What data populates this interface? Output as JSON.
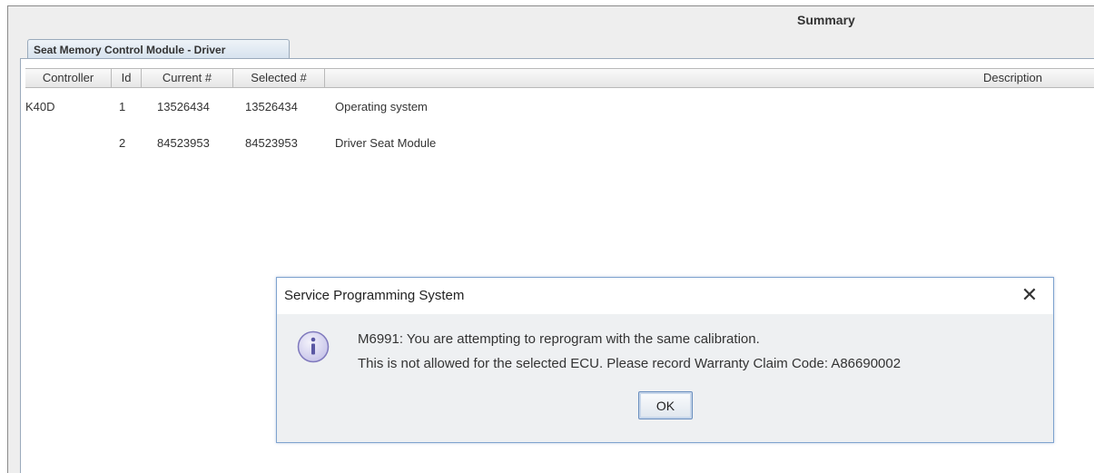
{
  "summary": {
    "title": "Summary"
  },
  "tab": {
    "label": "Seat Memory Control Module - Driver"
  },
  "table": {
    "columns": [
      "Controller",
      "Id",
      "Current #",
      "Selected #",
      "Description"
    ],
    "rows": [
      {
        "controller": "K40D",
        "id": "1",
        "current": "13526434",
        "selected": "13526434",
        "description": "Operating system"
      },
      {
        "controller": "",
        "id": "2",
        "current": "84523953",
        "selected": "84523953",
        "description": "Driver Seat Module"
      }
    ]
  },
  "dialog": {
    "title": "Service Programming System",
    "close_glyph": "✕",
    "icon": "info-icon",
    "message_line1": "M6991: You are attempting to reprogram with the same calibration.",
    "message_line2": "This is not allowed for the selected ECU. Please record Warranty Claim Code: A86690002",
    "ok_label": "OK"
  },
  "colors": {
    "dialog_border": "#7fa3cf",
    "icon_fill": "#c9c6ea",
    "icon_stroke": "#7f79bd"
  }
}
